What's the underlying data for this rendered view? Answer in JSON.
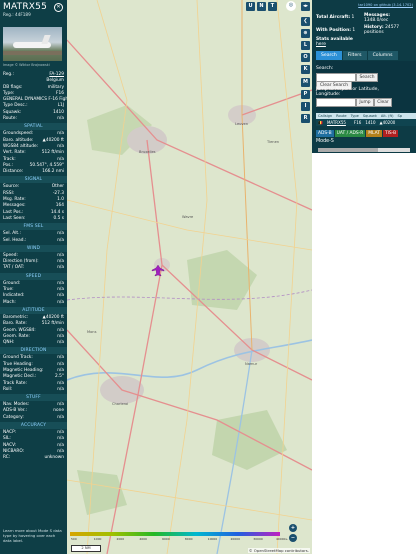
{
  "left": {
    "callsign": "MATRX55",
    "reg_line": "Reg.: 44F189",
    "photo_credit": "Image © Wiktor Brajnowski",
    "info_rows": [
      {
        "k": "Reg.:",
        "v": "FA-129",
        "link": true
      },
      {
        "k": "",
        "v": "Belgium"
      },
      {
        "k": "DB flags:",
        "v": "military"
      },
      {
        "k": "Type:",
        "v": "F16"
      },
      {
        "k": "",
        "v": "GENERAL DYNAMICS F-16 Fighting Falcon"
      },
      {
        "k": "Type Desc.:",
        "v": "L1J"
      },
      {
        "k": "Squawk:",
        "v": "1410"
      },
      {
        "k": "Route:",
        "v": "n/a"
      }
    ],
    "sections": [
      {
        "title": "SPATIAL",
        "rows": [
          {
            "k": "Groundspeed:",
            "v": "n/a"
          },
          {
            "k": "Baro. altitude:",
            "v": "▲40200 ft"
          },
          {
            "k": "WGS84 altitude:",
            "v": "n/a"
          },
          {
            "k": "Vert. Rate:",
            "v": "512 ft/min"
          },
          {
            "k": "Track:",
            "v": "n/a"
          },
          {
            "k": "Pos.:",
            "v": "50.547°, 4.559°"
          },
          {
            "k": "Distance:",
            "v": "166.2 nmi"
          }
        ]
      },
      {
        "title": "SIGNAL",
        "rows": [
          {
            "k": "Source:",
            "v": "Other"
          },
          {
            "k": "RSSI:",
            "v": "-27.3"
          },
          {
            "k": "Msg. Rate:",
            "v": "1.0"
          },
          {
            "k": "Messages:",
            "v": "164"
          },
          {
            "k": "Last Pos.:",
            "v": "14.4 s"
          },
          {
            "k": "Last Seen:",
            "v": "0.5 s"
          }
        ]
      },
      {
        "title": "FMS SEL",
        "rows": [
          {
            "k": "Sel. Alt.:",
            "v": "n/a"
          },
          {
            "k": "Sel. Head.:",
            "v": "n/a"
          }
        ]
      },
      {
        "title": "WIND",
        "rows": [
          {
            "k": "Speed:",
            "v": "n/a"
          },
          {
            "k": "Direction (from):",
            "v": "n/a"
          },
          {
            "k": "TAT / OAT:",
            "v": "n/a"
          }
        ]
      },
      {
        "title": "SPEED",
        "rows": [
          {
            "k": "Ground:",
            "v": "n/a"
          },
          {
            "k": "True:",
            "v": "n/a"
          },
          {
            "k": "Indicated:",
            "v": "n/a"
          },
          {
            "k": "Mach:",
            "v": "n/a"
          }
        ]
      },
      {
        "title": "ALTITUDE",
        "rows": [
          {
            "k": "Barometric:",
            "v": "▲40200 ft"
          },
          {
            "k": "Baro. Rate:",
            "v": "512 ft/min"
          },
          {
            "k": "Geom. WGS84:",
            "v": "n/a"
          },
          {
            "k": "Geom. Rate:",
            "v": "n/a"
          },
          {
            "k": "QNH:",
            "v": "n/a"
          }
        ]
      },
      {
        "title": "DIRECTION",
        "rows": [
          {
            "k": "Ground Track:",
            "v": "n/a"
          },
          {
            "k": "True Heading:",
            "v": "n/a"
          },
          {
            "k": "Magnetic Heading:",
            "v": "n/a"
          },
          {
            "k": "Magnetic Decl.:",
            "v": "2.5°"
          },
          {
            "k": "Track Rate:",
            "v": "n/a"
          },
          {
            "k": "Roll:",
            "v": "n/a"
          }
        ]
      },
      {
        "title": "STUFF",
        "rows": [
          {
            "k": "Nav. Modes:",
            "v": "n/a"
          },
          {
            "k": "ADS-B Ver.:",
            "v": "none"
          },
          {
            "k": "Category:",
            "v": "n/a"
          }
        ]
      },
      {
        "title": "ACCURACY",
        "rows": [
          {
            "k": "NACP:",
            "v": "n/a"
          },
          {
            "k": "SIL:",
            "v": "n/a"
          },
          {
            "k": "NACV:",
            "v": "n/a"
          },
          {
            "k": "NICBARO:",
            "v": "n/a"
          },
          {
            "k": "RC:",
            "v": "unknown"
          }
        ]
      }
    ],
    "note": "Learn more about Mode S data type by hovering over each data label."
  },
  "map": {
    "town_labels": [
      "Bruxelles",
      "Leuven",
      "Namur",
      "Charleroi",
      "Wavre",
      "Mons",
      "Tienen"
    ],
    "attribution": "© OpenStreetMap contributors.",
    "scale_label": "2 NM",
    "altitude_scale_ticks": [
      "500",
      "1000",
      "2000",
      "4000",
      "6000",
      "8000",
      "10000",
      "20000",
      "30000",
      "40000+"
    ],
    "buttons_top": [
      "U",
      "N",
      "T"
    ],
    "buttons_side": [
      "L",
      "O",
      "K",
      "M",
      "P",
      "I",
      "R"
    ],
    "zoom_in": "+",
    "zoom_out": "−"
  },
  "right": {
    "top_link": "tar1090 on github (3.14.1702)",
    "total_aircraft_label": "Total Aircraft:",
    "total_aircraft": "1",
    "messages_label": "Messages:",
    "messages_rate": "1348.0/sec",
    "with_position_label": "With Position:",
    "with_position": "1",
    "history_label": "History:",
    "history": "24577 positions",
    "stats_label": "Stats available",
    "stats_link": "here",
    "tabs": [
      "Search",
      "Filters",
      "Columns"
    ],
    "search_label": "Search:",
    "search_button": "Search",
    "clear_search_button": "Clear Search",
    "jump_label": "Jump to Airport or Latitude, Longitude:",
    "jump_button": "Jump",
    "clear_button": "Clear",
    "columns": [
      "Callsign",
      "Route",
      "Type",
      "Squawk",
      "Alt. (ft)",
      "Sp"
    ],
    "rows": [
      {
        "callsign": "MATRX55",
        "route": "",
        "type": "F16",
        "squawk": "1410",
        "alt": "▲40200",
        "flag": "🇧🇪"
      }
    ],
    "legend": [
      {
        "label": "ADS-B",
        "color": "#1f6fa0"
      },
      {
        "label": "UAT / ADS-R",
        "color": "#2b8a44"
      },
      {
        "label": "MLAT",
        "color": "#b3801b"
      },
      {
        "label": "TIS-B",
        "color": "#b02020"
      }
    ],
    "mode_s_label": "Mode-S"
  }
}
